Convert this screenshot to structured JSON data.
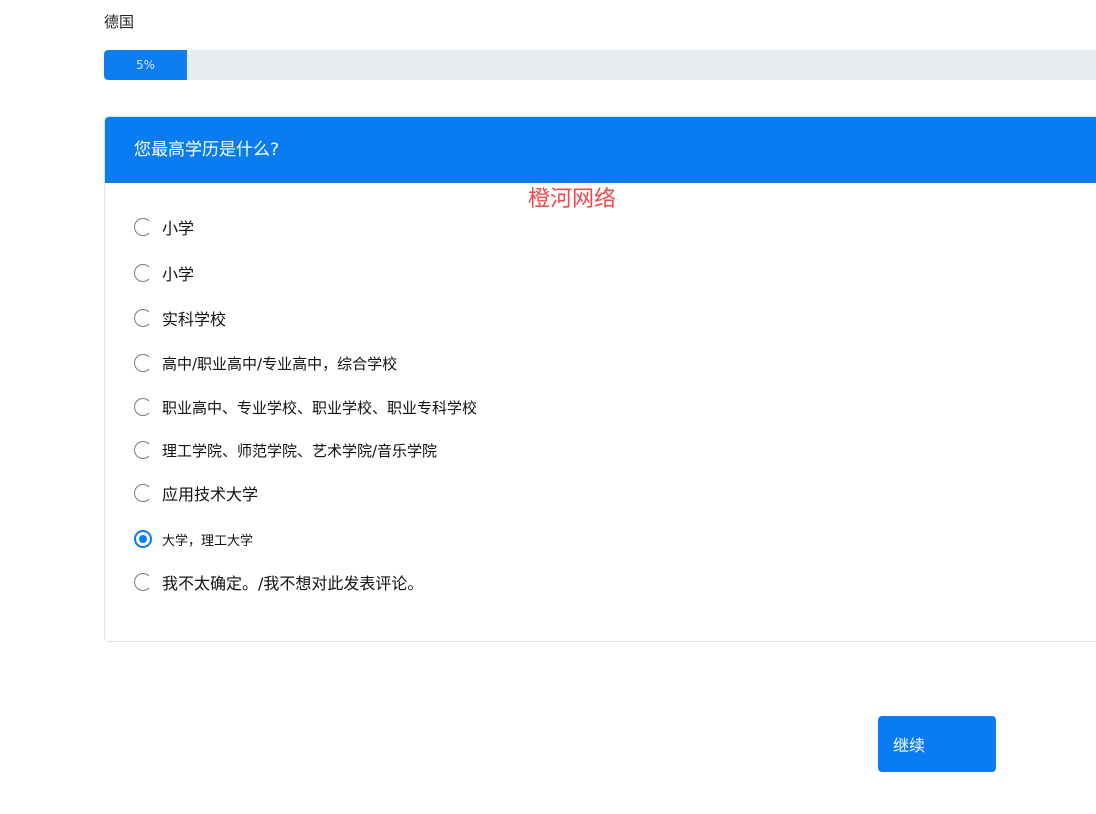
{
  "header": {
    "country": "德国"
  },
  "progress": {
    "label": "5%",
    "value": 0.05
  },
  "question": {
    "title": "您最高学历是什么?",
    "watermark": "橙河网络",
    "options": [
      {
        "label": "小学",
        "checked": false
      },
      {
        "label": "小学",
        "checked": false
      },
      {
        "label": "实科学校",
        "checked": false
      },
      {
        "label": "高中/职业高中/专业高中，综合学校",
        "checked": false
      },
      {
        "label": "职业高中、专业学校、职业学校、职业专科学校",
        "checked": false
      },
      {
        "label": "理工学院、师范学院、艺术学院/音乐学院",
        "checked": false
      },
      {
        "label": "应用技术大学",
        "checked": false
      },
      {
        "label": "大学，理工大学",
        "checked": true
      },
      {
        "label": "我不太确定。/我不想对此发表评论。",
        "checked": false
      }
    ]
  },
  "actions": {
    "continue_label": "继续"
  },
  "colors": {
    "primary": "#0a7cf2",
    "track": "#e9ecef",
    "watermark": "#f0484c"
  }
}
